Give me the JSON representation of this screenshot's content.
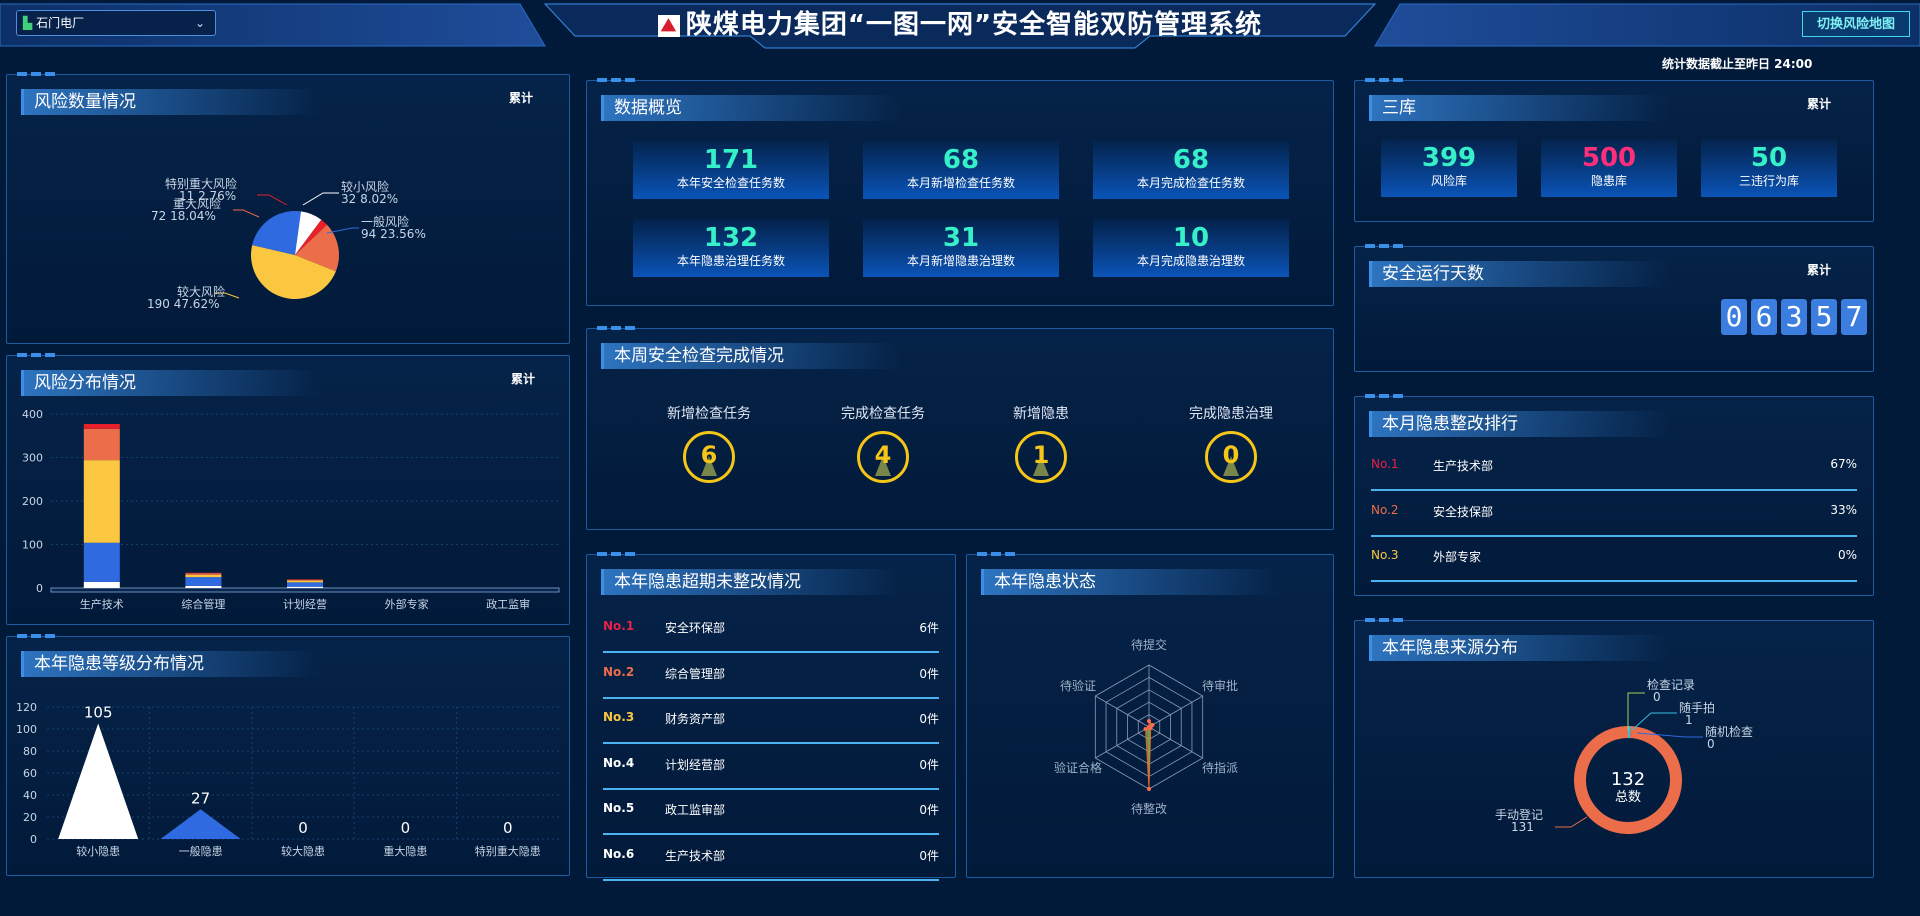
{
  "header": {
    "title": "陕煤电力集团“一图一网”安全智能双防管理系统",
    "plant_select": "石门电厂",
    "switch_button": "切换风险地图",
    "stats_note": "统计数据截止至昨日 24:00"
  },
  "risk_count": {
    "title": "风险数量情况",
    "tag": "累计",
    "chart_data": {
      "type": "pie",
      "slices": [
        {
          "name": "较大风险",
          "value": 190,
          "percent": "47.62%",
          "color": "#fbc740"
        },
        {
          "name": "一般风险",
          "value": 94,
          "percent": "23.56%",
          "color": "#2f6ae0"
        },
        {
          "name": "较小风险",
          "value": 32,
          "percent": "8.02%",
          "color": "#ffffff"
        },
        {
          "name": "特别重大风险",
          "value": 11,
          "percent": "2.76%",
          "color": "#e8202a"
        },
        {
          "name": "重大风险",
          "value": 72,
          "percent": "18.04%",
          "color": "#ec6d4a"
        }
      ],
      "labels": {
        "s0_name": "较大风险",
        "s0_val": "190 47.62%",
        "s1_name": "一般风险",
        "s1_val": "94 23.56%",
        "s2_name": "较小风险",
        "s2_val": "32 8.02%",
        "s3_name": "特别重大风险",
        "s3_val": "11 2.76%",
        "s4_name": "重大风险",
        "s4_val": "72 18.04%"
      }
    }
  },
  "risk_distribution": {
    "title": "风险分布情况",
    "tag": "累计",
    "chart_data": {
      "type": "bar",
      "stacked": true,
      "categories": [
        "生产技术",
        "综合管理",
        "计划经营",
        "外部专家",
        "政工监审"
      ],
      "ylim": [
        0,
        400
      ],
      "yticks": [
        "0",
        "100",
        "200",
        "300",
        "400"
      ],
      "series": [
        {
          "color": "#ffffff",
          "values": [
            14,
            5,
            3,
            0,
            0
          ]
        },
        {
          "color": "#2f6ae0",
          "values": [
            90,
            20,
            10,
            0,
            0
          ]
        },
        {
          "color": "#fbc740",
          "values": [
            190,
            5,
            4,
            0,
            0
          ]
        },
        {
          "color": "#ec6d4a",
          "values": [
            72,
            4,
            2,
            0,
            0
          ]
        },
        {
          "color": "#e8202a",
          "values": [
            11,
            1,
            1,
            0,
            0
          ]
        }
      ]
    }
  },
  "hazard_level": {
    "title": "本年隐患等级分布情况",
    "chart_data": {
      "type": "bar",
      "categories": [
        "较小隐患",
        "一般隐患",
        "较大隐患",
        "重大隐患",
        "特别重大隐患"
      ],
      "values": [
        105,
        27,
        0,
        0,
        0
      ],
      "value_labels": [
        "105",
        "27",
        "0",
        "0",
        "0"
      ],
      "colors": [
        "#ffffff",
        "#2f6ae0",
        "#fbc740",
        "#ec6d4a",
        "#e8202a"
      ],
      "ylim": [
        0,
        120
      ],
      "yticks": [
        "0",
        "20",
        "40",
        "60",
        "80",
        "100",
        "120"
      ]
    }
  },
  "overview": {
    "title": "数据概览",
    "items": [
      {
        "value": "171",
        "label": "本年安全检查任务数"
      },
      {
        "value": "68",
        "label": "本月新增检查任务数"
      },
      {
        "value": "68",
        "label": "本月完成检查任务数"
      },
      {
        "value": "132",
        "label": "本年隐患治理任务数"
      },
      {
        "value": "31",
        "label": "本月新增隐患治理数"
      },
      {
        "value": "10",
        "label": "本月完成隐患治理数"
      }
    ]
  },
  "weekly": {
    "title": "本周安全检查完成情况",
    "items": [
      {
        "label": "新增检查任务",
        "value": "6"
      },
      {
        "label": "完成检查任务",
        "value": "4"
      },
      {
        "label": "新增隐患",
        "value": "1"
      },
      {
        "label": "完成隐患治理",
        "value": "0"
      }
    ]
  },
  "overdue": {
    "title": "本年隐患超期未整改情况",
    "rows": [
      {
        "rank": "No.1",
        "dept": "安全环保部",
        "count": "6件",
        "color": "#e8204a"
      },
      {
        "rank": "No.2",
        "dept": "综合管理部",
        "count": "0件",
        "color": "#ec6d4a"
      },
      {
        "rank": "No.3",
        "dept": "财务资产部",
        "count": "0件",
        "color": "#fbc740"
      },
      {
        "rank": "No.4",
        "dept": "计划经营部",
        "count": "0件",
        "color": "#ffffff"
      },
      {
        "rank": "No.5",
        "dept": "政工监审部",
        "count": "0件",
        "color": "#ffffff"
      },
      {
        "rank": "No.6",
        "dept": "生产技术部",
        "count": "0件",
        "color": "#ffffff"
      }
    ]
  },
  "hazard_status": {
    "title": "本年隐患状态",
    "chart_data": {
      "type": "radar",
      "axes": [
        "待提交",
        "待审批",
        "待指派",
        "待整改",
        "验证合格",
        "待验证"
      ],
      "values": [
        3,
        2,
        1,
        31,
        2,
        0
      ],
      "max": 31
    }
  },
  "three_libs": {
    "title": "三库",
    "tag": "累计",
    "items": [
      {
        "value": "399",
        "label": "风险库",
        "color": "#36f0c8"
      },
      {
        "value": "500",
        "label": "隐患库",
        "color": "#ff2e7a"
      },
      {
        "value": "50",
        "label": "三违行为库",
        "color": "#36f0c8"
      }
    ]
  },
  "safe_days": {
    "title": "安全运行天数",
    "tag": "累计",
    "digits": [
      "0",
      "6",
      "3",
      "5",
      "7"
    ]
  },
  "rectify_rank": {
    "title": "本月隐患整改排行",
    "rows": [
      {
        "rank": "No.1",
        "dept": "生产技术部",
        "pct": "67%",
        "color": "#e8204a"
      },
      {
        "rank": "No.2",
        "dept": "安全技保部",
        "pct": "33%",
        "color": "#ec6d4a"
      },
      {
        "rank": "No.3",
        "dept": "外部专家",
        "pct": "0%",
        "color": "#fbc740"
      }
    ]
  },
  "hazard_source": {
    "title": "本年隐患来源分布",
    "total": "132",
    "total_label": "总数",
    "chart_data": {
      "type": "pie",
      "donut": true,
      "slices": [
        {
          "name": "检查记录",
          "value": 0,
          "color": "#9ad25a"
        },
        {
          "name": "随手拍",
          "value": 1,
          "color": "#36c0e0"
        },
        {
          "name": "随机检查",
          "value": 0,
          "color": "#2f6ae0"
        },
        {
          "name": "手动登记",
          "value": 131,
          "color": "#ec6d4a"
        }
      ],
      "labels": {
        "s0_name": "检查记录",
        "s0_val": "0",
        "s1_name": "随手拍",
        "s1_val": "1",
        "s2_name": "随机检查",
        "s2_val": "0",
        "s3_name": "手动登记",
        "s3_val": "131"
      }
    }
  }
}
